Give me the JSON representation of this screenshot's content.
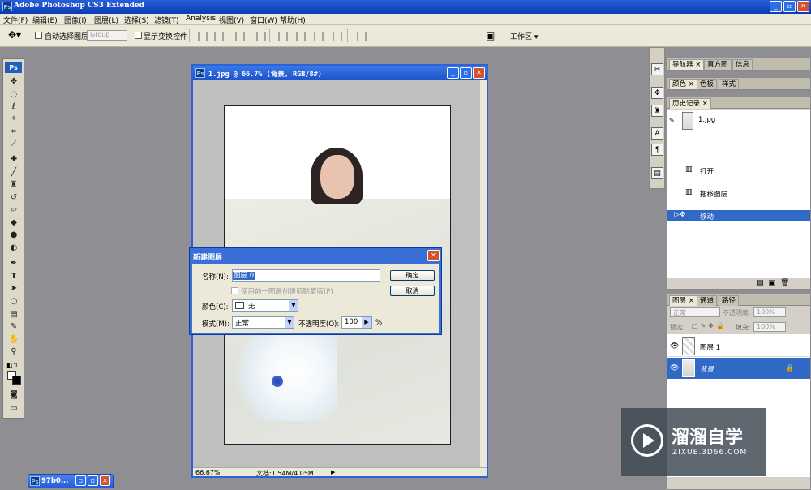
{
  "app": {
    "icon_label": "Ps",
    "title": "Adobe Photoshop CS3 Extended",
    "window_buttons": [
      "_",
      "▫",
      "✕"
    ]
  },
  "menu": [
    "文件(F)",
    "编辑(E)",
    "图像(I)",
    "图层(L)",
    "选择(S)",
    "滤镜(T)",
    "Analysis",
    "视图(V)",
    "窗口(W)",
    "帮助(H)"
  ],
  "options": {
    "auto_select_label": "自动选择图层",
    "auto_select_value": "Group",
    "show_transform_label": "显示变换控件",
    "workspace_label": "工作区 ▾"
  },
  "toolbox": {
    "badge": "Ps",
    "tool_icons": [
      "move-tool-icon",
      "marquee-tool-icon",
      "lasso-tool-icon",
      "magic-wand-icon",
      "crop-tool-icon",
      "slice-tool-icon",
      "healing-brush-icon",
      "brush-tool-icon",
      "clone-stamp-icon",
      "history-brush-icon",
      "eraser-icon",
      "paint-bucket-icon",
      "blur-tool-icon",
      "dodge-tool-icon",
      "pen-tool-icon",
      "type-tool-icon",
      "path-select-icon",
      "shape-tool-icon",
      "notes-tool-icon",
      "eyedropper-icon",
      "hand-tool-icon",
      "zoom-tool-icon",
      "color-swatch-icon",
      "quick-mask-icon",
      "screen-mode-icon"
    ]
  },
  "navigator_panel": {
    "tabs": [
      "导航器 ×",
      "直方图",
      "信息"
    ]
  },
  "color_panel": {
    "tabs": [
      "颜色 ×",
      "色板",
      "样式"
    ]
  },
  "history_panel": {
    "tab": "历史记录 ×",
    "snapshot": "1.jpg",
    "items": [
      "打开",
      "拖移图层",
      "移动"
    ]
  },
  "layers_panel": {
    "tabs": [
      "图层 ×",
      "通道",
      "路径"
    ],
    "blend_mode": "正常",
    "opacity_label": "不透明度:",
    "opacity_value": "100%",
    "lock_label": "锁定:",
    "fill_label": "填充:",
    "fill_value": "100%",
    "layers": [
      "图层 1",
      "背景"
    ]
  },
  "document": {
    "title": "1.jpg @ 66.7% (背景, RGB/8#)",
    "zoom": "66.67%",
    "doc_size": "文档:1.54M/4.05M"
  },
  "dialog": {
    "title": "新建图层",
    "name_label": "名称(N):",
    "name_value": "图层 0",
    "clip_label": "使用前一图层创建剪贴蒙版(P)",
    "color_label": "颜色(C):",
    "color_value": "无",
    "mode_label": "模式(M):",
    "mode_value": "正常",
    "opacity_label": "不透明度(O):",
    "opacity_value": "100",
    "opacity_unit": "%",
    "ok_label": "确定",
    "cancel_label": "取消"
  },
  "minimized_window": {
    "title": "97b0..."
  },
  "watermark": {
    "name": "溜溜自学",
    "url": "ZIXUE.3D66.COM"
  },
  "colors": {
    "xp_blue": "#245dd6",
    "canvas_bg": "#8f8e93",
    "selected_row": "#3169c6"
  }
}
